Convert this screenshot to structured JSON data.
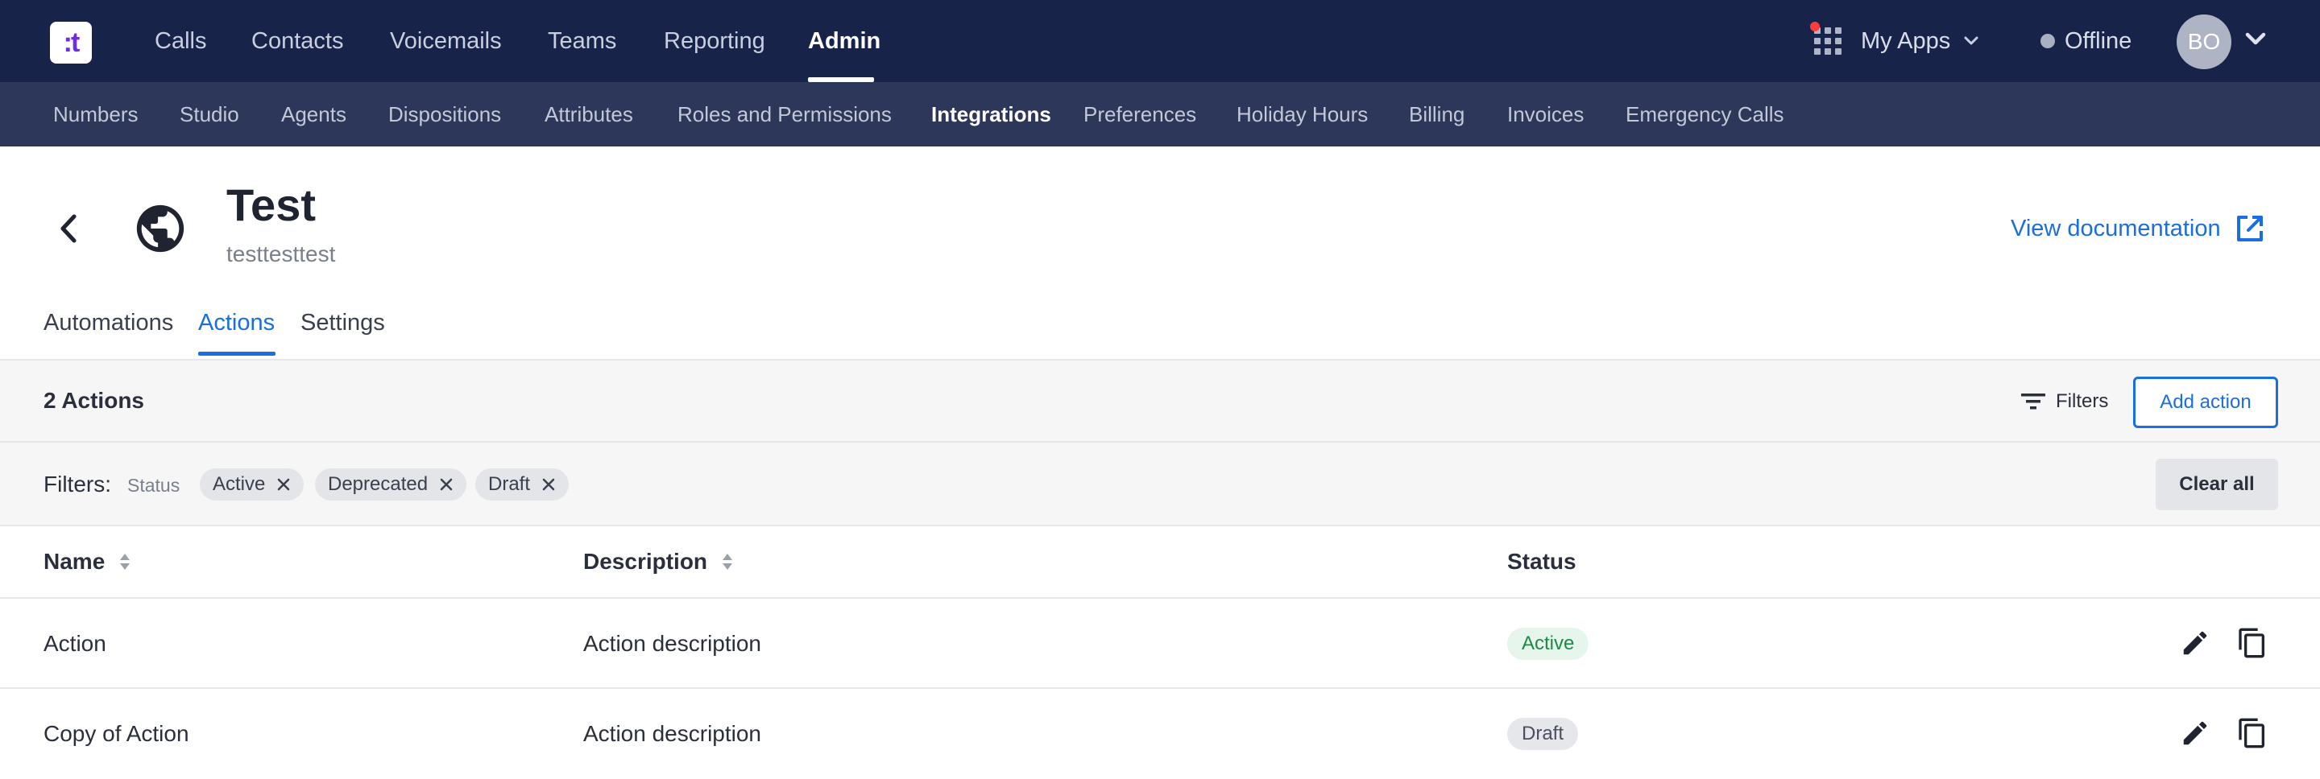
{
  "logo": {
    "glyph": ":t"
  },
  "topnav": {
    "items": [
      {
        "label": "Calls"
      },
      {
        "label": "Contacts"
      },
      {
        "label": "Voicemails"
      },
      {
        "label": "Teams"
      },
      {
        "label": "Reporting"
      },
      {
        "label": "Admin",
        "active": true
      }
    ],
    "apps_label": "My Apps",
    "status_label": "Offline",
    "avatar_initials": "BO"
  },
  "subnav": {
    "items": [
      {
        "label": "Numbers"
      },
      {
        "label": "Studio"
      },
      {
        "label": "Agents"
      },
      {
        "label": "Dispositions"
      },
      {
        "label": "Attributes"
      },
      {
        "label": "Roles and Permissions"
      },
      {
        "label": "Integrations",
        "active": true
      },
      {
        "label": "Preferences"
      },
      {
        "label": "Holiday Hours"
      },
      {
        "label": "Billing"
      },
      {
        "label": "Invoices"
      },
      {
        "label": "Emergency Calls"
      }
    ]
  },
  "header": {
    "title": "Test",
    "subtitle": "testtesttest",
    "doc_link": "View documentation"
  },
  "tabs": [
    {
      "label": "Automations"
    },
    {
      "label": "Actions",
      "active": true
    },
    {
      "label": "Settings"
    }
  ],
  "toolbar": {
    "count_label": "2 Actions",
    "filters_label": "Filters",
    "add_label": "Add action"
  },
  "filters": {
    "label": "Filters:",
    "key": "Status",
    "chips": [
      {
        "label": "Active"
      },
      {
        "label": "Deprecated"
      },
      {
        "label": "Draft"
      }
    ],
    "clear_label": "Clear all"
  },
  "table": {
    "columns": [
      {
        "label": "Name",
        "sortable": true
      },
      {
        "label": "Description",
        "sortable": true
      },
      {
        "label": "Status",
        "sortable": false
      }
    ],
    "rows": [
      {
        "name": "Action",
        "description": "Action description",
        "status": "Active"
      },
      {
        "name": "Copy of Action",
        "description": "Action description",
        "status": "Draft"
      }
    ]
  },
  "colors": {
    "nav_bg": "#18234a",
    "subnav_bg": "#2c3759",
    "accent": "#1a6ee0",
    "active_green": "#1e8a45",
    "notification_red": "#ff3b3b"
  },
  "icons": {
    "logo": "logo-icon",
    "apps": "apps-grid-icon",
    "chevron": "chevron-down-icon",
    "back": "chevron-left-icon",
    "integration": "globe-icon",
    "external": "external-link-icon",
    "filter": "filter-icon",
    "remove": "close-icon",
    "sort": "sort-icon",
    "edit": "pencil-icon",
    "copy": "copy-icon"
  }
}
